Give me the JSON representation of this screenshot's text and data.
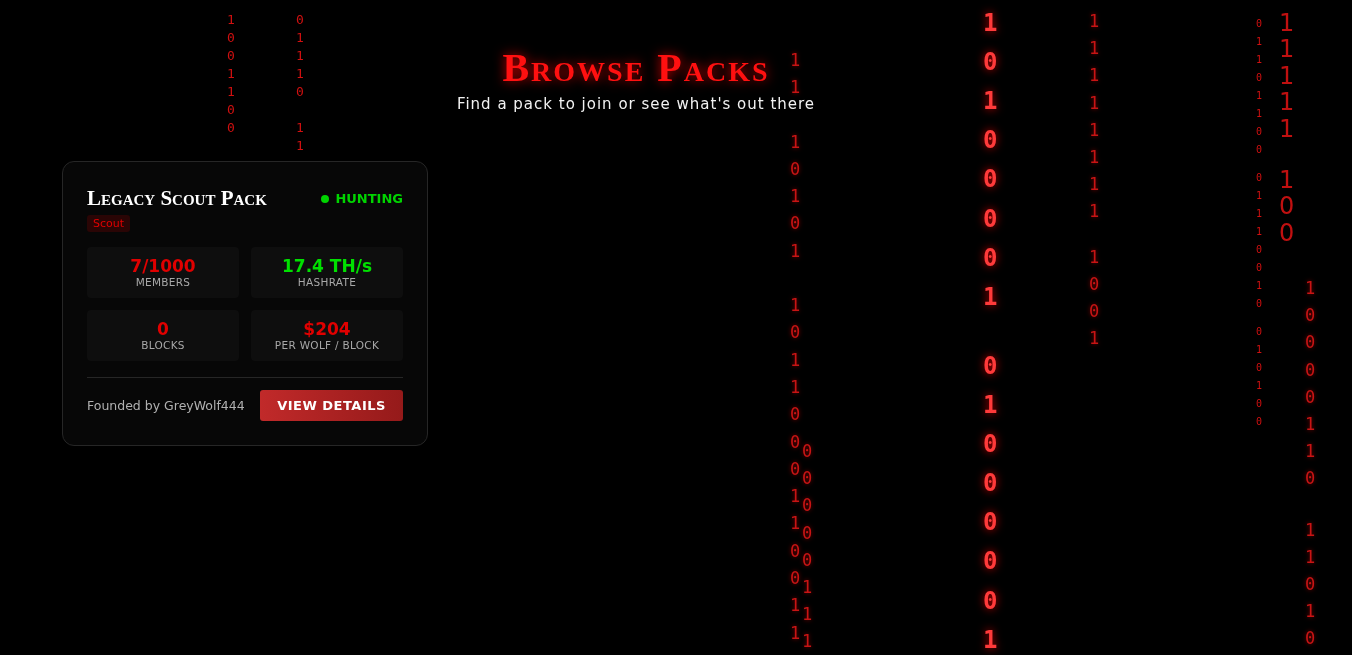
{
  "header": {
    "title": "Browse Packs",
    "subtitle": "Find a pack to join or see what's out there"
  },
  "rain": [
    {
      "segments": [
        "1001100"
      ]
    },
    {
      "segments": [
        "01110",
        "11"
      ]
    },
    {
      "segments": [
        "11",
        "10101",
        "1011000110011"
      ]
    },
    {
      "segments": [
        "00000111"
      ]
    },
    {
      "segments": [
        "10100001",
        "01000001"
      ]
    },
    {
      "segments": [
        "11111111",
        "1001"
      ]
    },
    {
      "segments": [
        "01101100",
        "01110010",
        "010100"
      ]
    },
    {
      "segments": [
        "11111",
        "100"
      ]
    },
    {
      "segments": [
        "10000110",
        "11010"
      ]
    }
  ],
  "packs": [
    {
      "name": "Legacy Scout Pack",
      "status": {
        "label": "HUNTING",
        "color": "#00d400"
      },
      "tier": "Scout",
      "stats": [
        {
          "value": "7/1000",
          "label": "MEMBERS",
          "color": "#e00000"
        },
        {
          "value": "17.4 TH/s",
          "label": "HASHRATE",
          "color": "#00e000"
        },
        {
          "value": "0",
          "label": "BLOCKS",
          "color": "#e00000"
        },
        {
          "value": "$204",
          "label": "PER WOLF / BLOCK",
          "color": "#e00000"
        }
      ],
      "founder": "Founded by GreyWolf444",
      "action": "VIEW DETAILS"
    }
  ]
}
